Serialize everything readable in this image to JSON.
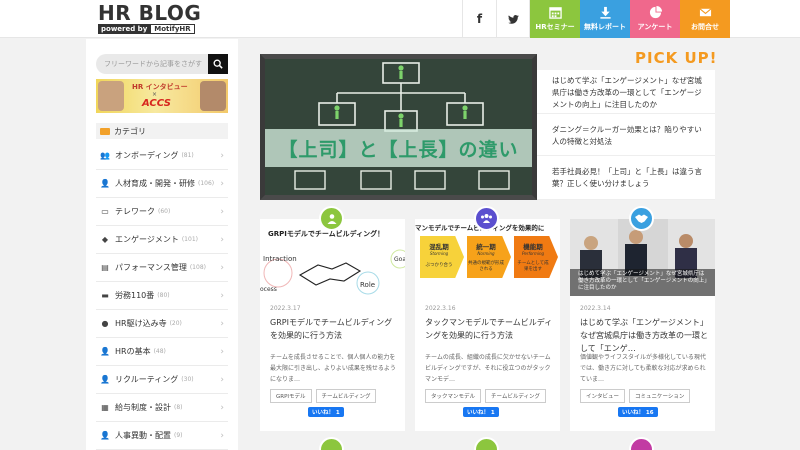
{
  "header": {
    "logo_main": "HR BLOG",
    "logo_powered": "powered by",
    "logo_brand": "MotifyHR",
    "social": [
      {
        "icon": "facebook-icon",
        "glyph": "f"
      },
      {
        "icon": "twitter-icon",
        "glyph": "t"
      }
    ],
    "nav_buttons": [
      {
        "label": "HRセミナー",
        "icon": "calendar-icon",
        "color": "#8cc63e"
      },
      {
        "label": "無料レポート",
        "icon": "download-icon",
        "color": "#3aa0e0"
      },
      {
        "label": "アンケート",
        "icon": "pie-chart-icon",
        "color": "#f0688c"
      },
      {
        "label": "お問合せ",
        "icon": "mail-icon",
        "color": "#f49a20"
      }
    ]
  },
  "sidebar": {
    "search_placeholder": "フリーワードから記事をさがす",
    "banner": {
      "title": "HR インタビュー",
      "x": "×",
      "brand": "ACCS"
    },
    "category_heading": "カテゴリ",
    "categories": [
      {
        "label": "オンボーディング",
        "count": "(81)",
        "icon": "users-icon"
      },
      {
        "label": "人材育成・開発・研修",
        "count": "(106)",
        "icon": "person-growth-icon"
      },
      {
        "label": "テレワーク",
        "count": "(60)",
        "icon": "laptop-icon"
      },
      {
        "label": "エンゲージメント",
        "count": "(101)",
        "icon": "handshake-icon"
      },
      {
        "label": "パフォーマンス管理",
        "count": "(108)",
        "icon": "clipboard-icon"
      },
      {
        "label": "労務110番",
        "count": "(80)",
        "icon": "desk-icon"
      },
      {
        "label": "HR駆け込み寺",
        "count": "(20)",
        "icon": "qa-icon"
      },
      {
        "label": "HRの基本",
        "count": "(48)",
        "icon": "person-icon"
      },
      {
        "label": "リクルーティング",
        "count": "(30)",
        "icon": "recruit-icon"
      },
      {
        "label": "給与制度・設計",
        "count": "(8)",
        "icon": "calculator-icon"
      },
      {
        "label": "人事異動・配置",
        "count": "(9)",
        "icon": "transfer-icon"
      }
    ]
  },
  "featured": {
    "title": "【上司】と【上長】の違い"
  },
  "pickup": {
    "title_main": "PICK",
    "title_up": "UP!",
    "items": [
      "はじめて学ぶ「エンゲージメント」なぜ宮城県庁は働き方改革の一環として「エンゲージメントの向上」に注目したのか",
      "ダニング＝クルーガー効果とは？陥りやすい人の特徴と対処法",
      "若手社員必見！「上司」と「上長」は違う言葉？正しく使い分けましょう"
    ]
  },
  "cards": [
    {
      "thumb_title": "GRPIモデルでチームビルディング！",
      "date": "2022.3.17",
      "title": "GRPIモデルでチームビルディングを効果的に行う方法",
      "excerpt": "チームを成長させることで、個人個人の能力を最大限に引き出し、よりよい成果を残せるようになりま…",
      "tags": [
        "GRPIモデル",
        "チームビルディング"
      ],
      "likes": "いいね！ 1",
      "badge_color": "#8cc63e",
      "badge_icon": "person-growth-icon"
    },
    {
      "thumb_title": "マンモデルでチームビルディングを効果的に",
      "date": "2022.3.16",
      "title": "タックマンモデルでチームビルディングを効果的に行う方法",
      "excerpt": "チームの成長、組織の成長に欠かせないチームビルディングですが、それに役立つのがタックマンモデ…",
      "tags": [
        "タックマンモデル",
        "チームビルディング"
      ],
      "likes": "いいね！ 1",
      "badge_color": "#5b4fcf",
      "badge_icon": "users-icon",
      "stages": [
        {
          "name": "混乱期",
          "en": "Storming",
          "desc": "ぶつかり合う",
          "color": "#f7d23a"
        },
        {
          "name": "統一期",
          "en": "Norming",
          "desc": "共通の規範が形成される",
          "color": "#f7a21a"
        },
        {
          "name": "機能期",
          "en": "Performing",
          "desc": "チームとして成果を出す",
          "color": "#f07a12"
        }
      ]
    },
    {
      "thumb_title": "はじめて学ぶ「エンゲージメント」なぜ宮城県庁は働き方改革の一環として「エンゲージメントの向上」に注目したのか",
      "date": "2022.3.14",
      "title": "はじめて学ぶ「エンゲージメント」なぜ宮城県庁は働き方改革の一環として「エンゲ…",
      "excerpt": "価値観やライフスタイルが多様化している現代では、働き方に対しても柔軟な対応が求められていま…",
      "tags": [
        "インタビュー",
        "コミュニケーション"
      ],
      "likes": "いいね！ 16",
      "badge_color": "#3aa0e0",
      "badge_icon": "handshake-icon"
    }
  ]
}
